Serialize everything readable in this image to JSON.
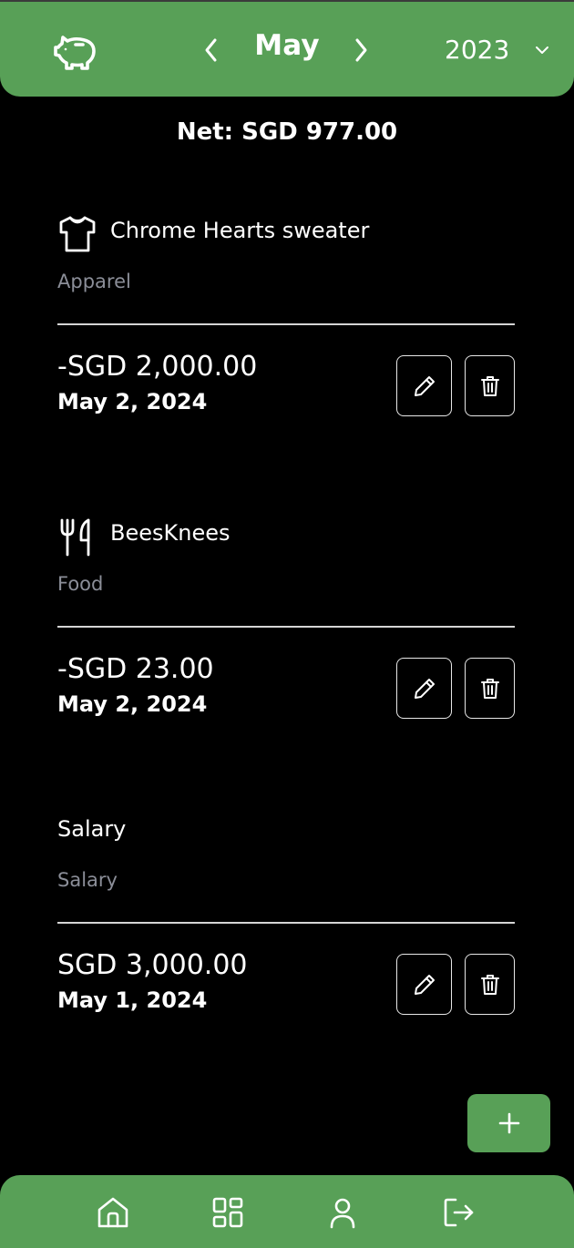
{
  "header": {
    "logo_icon": "piggy-bank-icon",
    "prev_icon": "chevron-left-icon",
    "next_icon": "chevron-right-icon",
    "month": "May",
    "year": "2023",
    "year_dropdown_icon": "chevron-down-icon",
    "background_color": "#58a057"
  },
  "net": {
    "label": "Net: SGD 977.00"
  },
  "transactions": [
    {
      "title": "Chrome Hearts sweater",
      "category": "Apparel",
      "icon": "shirt-icon",
      "amount": "-SGD 2,000.00",
      "date": "May 2, 2024",
      "edit_icon": "pencil-icon",
      "delete_icon": "trash-icon"
    },
    {
      "title": "BeesKnees",
      "category": "Food",
      "icon": "utensils-icon",
      "amount": "-SGD 23.00",
      "date": "May 2, 2024",
      "edit_icon": "pencil-icon",
      "delete_icon": "trash-icon"
    },
    {
      "title": "Salary",
      "category": "Salary",
      "icon": "",
      "amount": "SGD 3,000.00",
      "date": "May 1, 2024",
      "edit_icon": "pencil-icon",
      "delete_icon": "trash-icon"
    }
  ],
  "fab": {
    "icon": "plus-icon"
  },
  "bottom_nav": {
    "items": [
      {
        "icon": "home-icon"
      },
      {
        "icon": "dashboard-icon"
      },
      {
        "icon": "user-icon"
      },
      {
        "icon": "logout-icon"
      }
    ]
  },
  "colors": {
    "accent": "#58a057",
    "background": "#000000",
    "muted_text": "#8b8e98"
  }
}
